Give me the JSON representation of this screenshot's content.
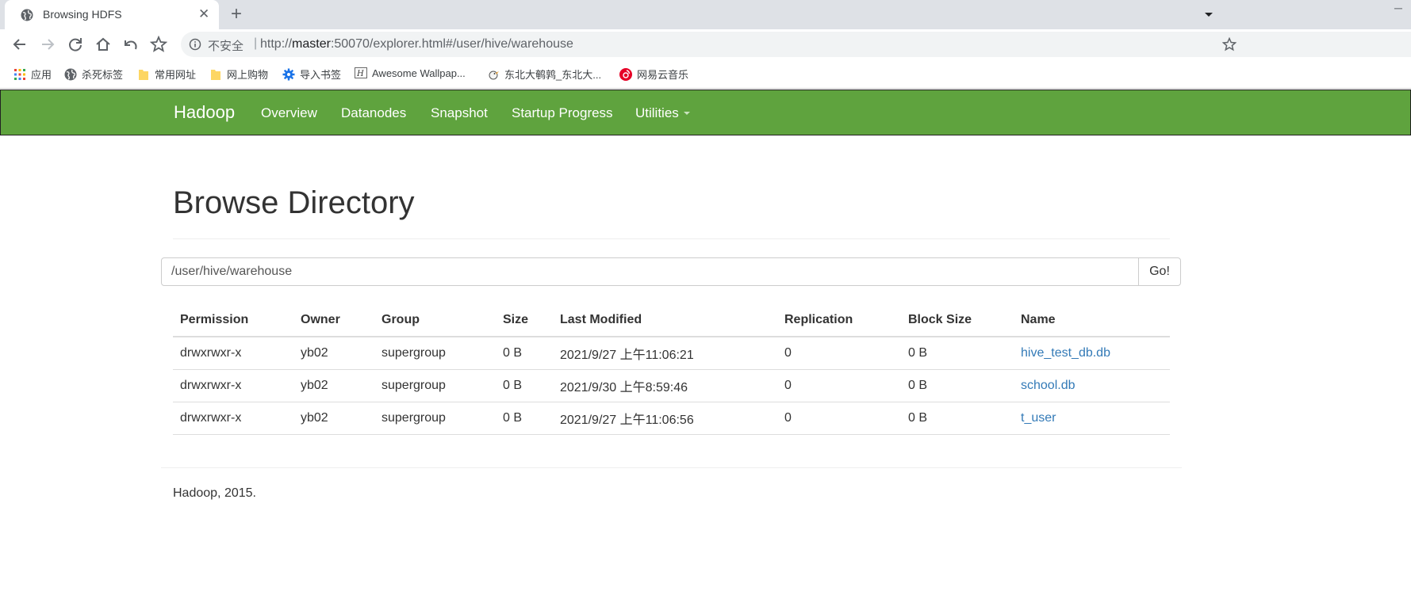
{
  "browser": {
    "tab_title": "Browsing HDFS",
    "new_tab": "+",
    "close": "✕",
    "insecure_label": "不安全",
    "separator": "|",
    "url_prefix": "http://",
    "url_host": "master",
    "url_rest": ":50070/explorer.html#/user/hive/warehouse"
  },
  "bookmarks": [
    {
      "label": "应用",
      "icon": "apps-grid-icon"
    },
    {
      "label": "杀死标签",
      "icon": "globe-icon"
    },
    {
      "label": "常用网址",
      "icon": "folder-icon"
    },
    {
      "label": "网上购物",
      "icon": "folder-icon"
    },
    {
      "label": "导入书签",
      "icon": "gear-icon"
    },
    {
      "label": "Awesome Wallpap...",
      "icon": "wallpaper-icon"
    },
    {
      "label": "东北大鹌鹑_东北大...",
      "icon": "bird-icon"
    },
    {
      "label": "网易云音乐",
      "icon": "netease-music-icon"
    }
  ],
  "navbar": {
    "brand": "Hadoop",
    "items": [
      "Overview",
      "Datanodes",
      "Snapshot",
      "Startup Progress",
      "Utilities"
    ],
    "color": "#5fa33e"
  },
  "main": {
    "title": "Browse Directory",
    "path_value": "/user/hive/warehouse",
    "go_label": "Go!"
  },
  "table": {
    "headers": [
      "Permission",
      "Owner",
      "Group",
      "Size",
      "Last Modified",
      "Replication",
      "Block Size",
      "Name"
    ],
    "rows": [
      [
        "drwxrwxr-x",
        "yb02",
        "supergroup",
        "0 B",
        "2021/9/27 上午11:06:21",
        "0",
        "0 B",
        "hive_test_db.db"
      ],
      [
        "drwxrwxr-x",
        "yb02",
        "supergroup",
        "0 B",
        "2021/9/30 上午8:59:46",
        "0",
        "0 B",
        "school.db"
      ],
      [
        "drwxrwxr-x",
        "yb02",
        "supergroup",
        "0 B",
        "2021/9/27 上午11:06:56",
        "0",
        "0 B",
        "t_user"
      ]
    ]
  },
  "footer": "Hadoop, 2015.",
  "colors": {
    "link": "#337ab7",
    "navbar": "#5fa33e"
  }
}
